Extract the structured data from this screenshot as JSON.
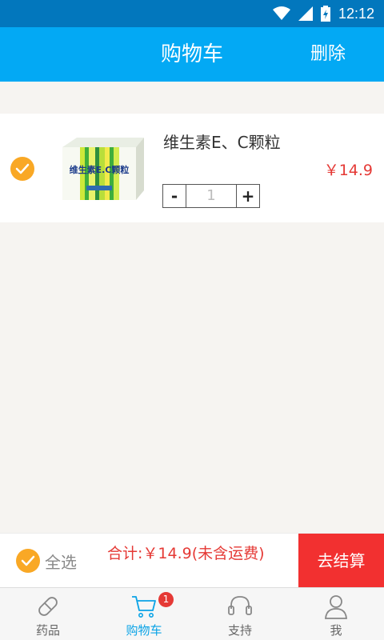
{
  "status_bar": {
    "time": "12:12"
  },
  "header": {
    "title": "购物车",
    "delete_label": "删除"
  },
  "cart": {
    "items": [
      {
        "name": "维生素E、C颗粒",
        "price": "￥14.9",
        "quantity": "1",
        "checked": true,
        "image_text": "维生素E.C颗粒"
      }
    ],
    "minus_label": "-",
    "plus_label": "+"
  },
  "checkout": {
    "select_all_label": "全选",
    "total_text": "合计:￥14.9(未含运费)",
    "checkout_label": "去结算"
  },
  "nav": {
    "items": [
      {
        "label": "药品",
        "icon": "pill-icon"
      },
      {
        "label": "购物车",
        "icon": "cart-icon",
        "active": true
      },
      {
        "label": "支持",
        "icon": "headset-icon"
      },
      {
        "label": "我",
        "icon": "person-icon"
      }
    ],
    "cart_badge": "1"
  },
  "colors": {
    "status_bar": "#0277bd",
    "header": "#03a9f4",
    "price": "#e53935",
    "checkout": "#f23030",
    "check": "#f9a825",
    "active_nav": "#0aa3e6"
  }
}
